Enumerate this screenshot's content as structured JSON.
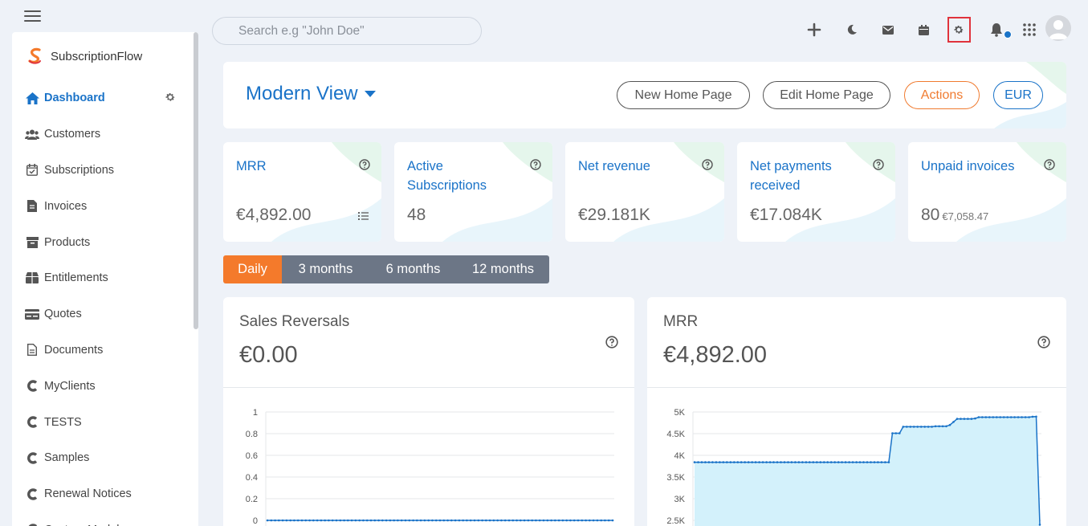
{
  "sidebar": {
    "brand": "SubscriptionFlow",
    "items": [
      {
        "label": "Dashboard",
        "icon": "home-icon",
        "active": true
      },
      {
        "label": "Customers",
        "icon": "users-icon"
      },
      {
        "label": "Subscriptions",
        "icon": "calendar-check-icon"
      },
      {
        "label": "Invoices",
        "icon": "invoice-icon"
      },
      {
        "label": "Products",
        "icon": "archive-icon"
      },
      {
        "label": "Entitlements",
        "icon": "box-icon"
      },
      {
        "label": "Quotes",
        "icon": "card-icon"
      },
      {
        "label": "Documents",
        "icon": "document-icon"
      },
      {
        "label": "MyClients",
        "icon": "c-icon"
      },
      {
        "label": "TESTS",
        "icon": "c-icon"
      },
      {
        "label": "Samples",
        "icon": "c-icon"
      },
      {
        "label": "Renewal Notices",
        "icon": "c-icon"
      },
      {
        "label": "Custom Modules",
        "icon": "c-icon"
      }
    ]
  },
  "topbar": {
    "search_placeholder": "Search e.g \"John Doe\"",
    "icons": [
      "plus-icon",
      "moon-icon",
      "mail-icon",
      "calendar-icon",
      "settings-icon",
      "bell-icon",
      "apps-grid-icon",
      "avatar"
    ],
    "accent": "#1a73c8",
    "highlight_color": "#e0333c"
  },
  "header": {
    "view_title": "Modern View",
    "buttons": {
      "new_home": "New Home Page",
      "edit_home": "Edit Home Page",
      "actions": "Actions",
      "currency": "EUR"
    }
  },
  "stats": [
    {
      "title": "MRR",
      "value": "€4,892.00",
      "sub": ""
    },
    {
      "title": "Active Subscriptions",
      "value": "48",
      "sub": ""
    },
    {
      "title": "Net revenue",
      "value": "€29.181K",
      "sub": ""
    },
    {
      "title": "Net payments received",
      "value": "€17.084K",
      "sub": ""
    },
    {
      "title": "Unpaid invoices",
      "value": "80",
      "sub": "€7,058.47"
    }
  ],
  "ranges": [
    "Daily",
    "3 months",
    "6 months",
    "12 months"
  ],
  "charts": {
    "sales_reversals": {
      "title": "Sales Reversals",
      "value": "€0.00"
    },
    "mrr": {
      "title": "MRR",
      "value": "€4,892.00"
    }
  },
  "chart_data": [
    {
      "type": "line",
      "title": "Sales Reversals",
      "y_ticks": [
        "1",
        "0.8",
        "0.6",
        "0.4",
        "0.2",
        "0"
      ],
      "ylim": [
        0,
        1
      ],
      "series": [
        {
          "values": [
            0,
            0,
            0,
            0,
            0,
            0,
            0,
            0,
            0,
            0,
            0,
            0,
            0,
            0,
            0,
            0,
            0,
            0,
            0,
            0,
            0,
            0,
            0,
            0,
            0,
            0,
            0,
            0,
            0,
            0,
            0,
            0,
            0,
            0,
            0,
            0,
            0,
            0,
            0,
            0,
            0,
            0,
            0,
            0,
            0,
            0,
            0,
            0,
            0,
            0,
            0,
            0,
            0,
            0,
            0,
            0,
            0,
            0,
            0,
            0,
            0,
            0,
            0,
            0,
            0,
            0,
            0,
            0,
            0,
            0,
            0,
            0,
            0,
            0,
            0,
            0,
            0,
            0,
            0,
            0,
            0,
            0,
            0,
            0,
            0,
            0,
            0,
            0,
            0,
            0,
            0
          ]
        }
      ],
      "grid": true
    },
    {
      "type": "area",
      "title": "MRR",
      "y_ticks": [
        "5K",
        "4.5K",
        "4K",
        "3.5K",
        "3K",
        "2.5K"
      ],
      "ylim": [
        2500,
        5000
      ],
      "series": [
        {
          "values": [
            3840,
            3840,
            3840,
            3840,
            3840,
            3840,
            3840,
            3840,
            3840,
            3840,
            3840,
            3840,
            3840,
            3840,
            3840,
            3840,
            3840,
            3840,
            3840,
            3840,
            3840,
            3840,
            3840,
            3840,
            3840,
            3840,
            3840,
            3840,
            3840,
            3840,
            3840,
            3840,
            3840,
            3840,
            3840,
            3840,
            3840,
            3840,
            3840,
            3840,
            3840,
            3840,
            3840,
            3840,
            3840,
            3840,
            3840,
            3840,
            3840,
            3840,
            3840,
            3840,
            3840,
            3840,
            3840,
            4510,
            4510,
            4510,
            4660,
            4660,
            4660,
            4660,
            4660,
            4660,
            4660,
            4660,
            4660,
            4670,
            4670,
            4670,
            4670,
            4700,
            4770,
            4840,
            4840,
            4840,
            4840,
            4840,
            4850,
            4880,
            4880,
            4880,
            4880,
            4880,
            4880,
            4880,
            4880,
            4880,
            4880,
            4880,
            4880,
            4880,
            4880,
            4880,
            4890,
            4892,
            2400
          ]
        }
      ],
      "fill_color": "#d3f1fb",
      "line_color": "#1a73c8",
      "grid": true
    }
  ]
}
